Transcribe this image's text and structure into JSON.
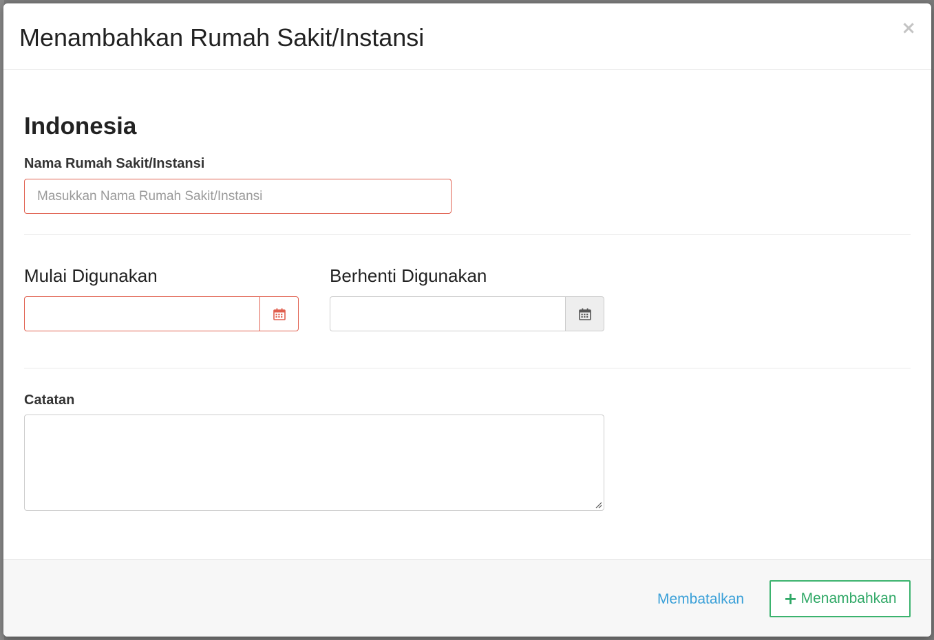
{
  "modal": {
    "title": "Menambahkan Rumah Sakit/Instansi",
    "close_symbol": "×"
  },
  "form": {
    "section_title": "Indonesia",
    "name_field": {
      "label": "Nama Rumah Sakit/Instansi",
      "placeholder": "Masukkan Nama Rumah Sakit/Instansi",
      "value": ""
    },
    "start_date": {
      "label": "Mulai Digunakan",
      "value": "",
      "icon": "calendar-icon",
      "icon_color": "#e05f4e"
    },
    "end_date": {
      "label": "Berhenti Digunakan",
      "value": "",
      "icon": "calendar-icon",
      "icon_color": "#555555"
    },
    "notes": {
      "label": "Catatan",
      "value": ""
    }
  },
  "footer": {
    "cancel_label": "Membatalkan",
    "add_label": "Menambahkan",
    "add_icon": "plus-icon",
    "accent_color": "#3bb36e",
    "link_color": "#3aa0d8"
  }
}
